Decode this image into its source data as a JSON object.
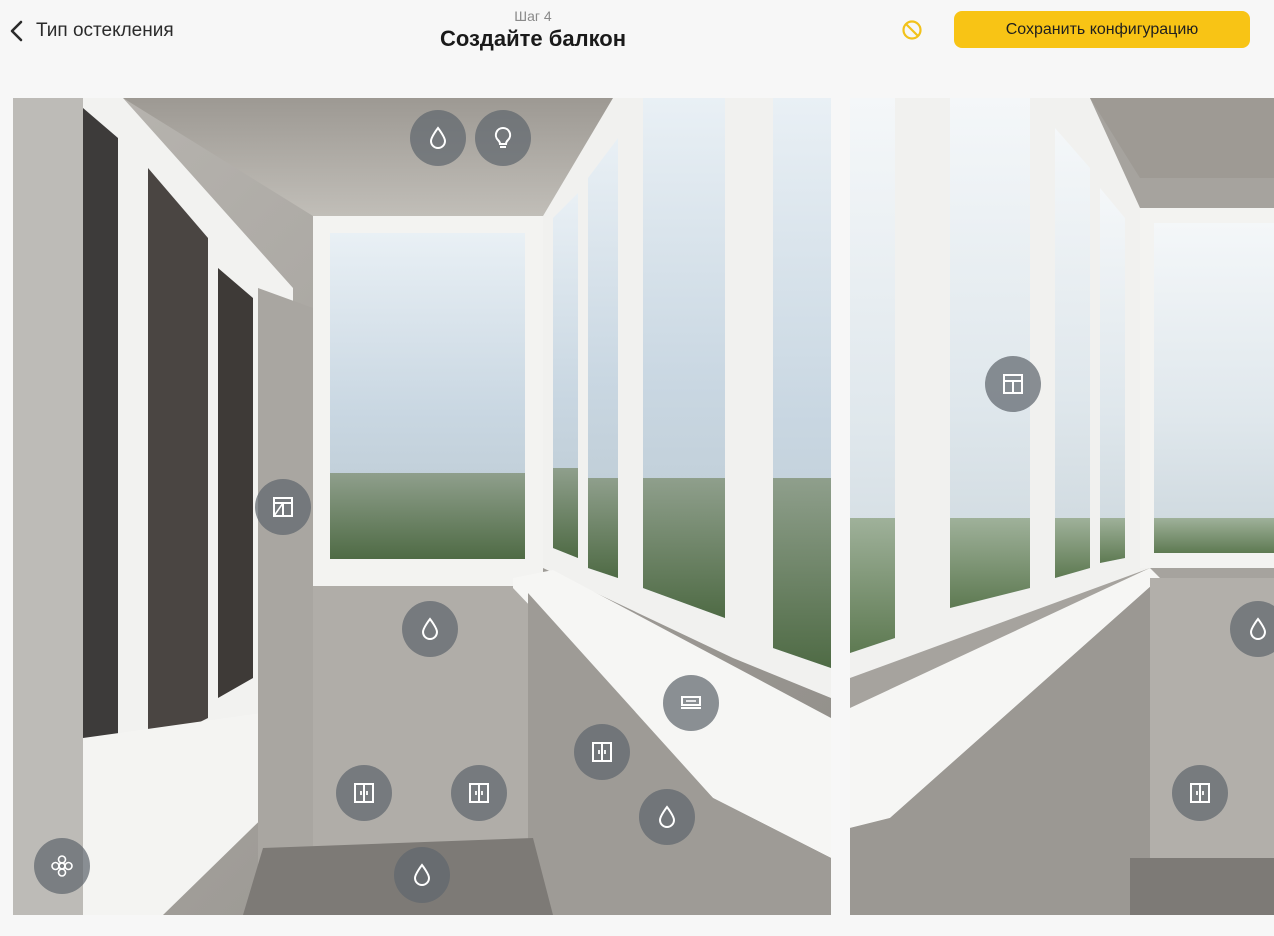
{
  "header": {
    "back_label": "Тип остекления",
    "step_label": "Шаг 4",
    "title": "Создайте балкон",
    "save_label": "Сохранить конфигурацию"
  },
  "colors": {
    "accent": "#f8c415",
    "hotspot": "#5f666e"
  },
  "hotspots": [
    {
      "icon": "drop-icon"
    },
    {
      "icon": "lightbulb-icon"
    },
    {
      "icon": "window-sash-icon"
    },
    {
      "icon": "drop-icon"
    },
    {
      "icon": "sill-icon"
    },
    {
      "icon": "cabinet-icon"
    },
    {
      "icon": "cabinet-icon"
    },
    {
      "icon": "cabinet-icon"
    },
    {
      "icon": "drop-icon"
    },
    {
      "icon": "drop-icon"
    },
    {
      "icon": "flower-icon"
    },
    {
      "icon": "window-frame-icon"
    },
    {
      "icon": "drop-icon"
    },
    {
      "icon": "cabinet-icon"
    }
  ]
}
